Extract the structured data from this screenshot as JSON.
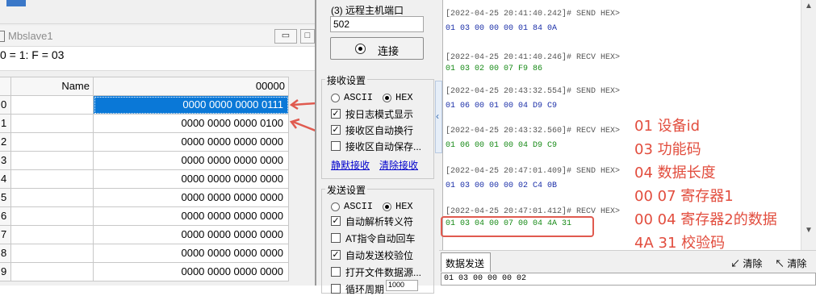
{
  "left_window": {
    "title": "Mbslave1",
    "status": "0 = 1: F = 03",
    "buttons": {
      "minimize": "▭",
      "maximize": "□"
    },
    "grid": {
      "header_name": "Name",
      "header_value": "00000",
      "rows": [
        {
          "num": "0",
          "value": "0000 0000 0000 0111",
          "selected": true
        },
        {
          "num": "1",
          "value": "0000 0000 0000 0100",
          "selected": false
        },
        {
          "num": "2",
          "value": "0000 0000 0000 0000",
          "selected": false
        },
        {
          "num": "3",
          "value": "0000 0000 0000 0000",
          "selected": false
        },
        {
          "num": "4",
          "value": "0000 0000 0000 0000",
          "selected": false
        },
        {
          "num": "5",
          "value": "0000 0000 0000 0000",
          "selected": false
        },
        {
          "num": "6",
          "value": "0000 0000 0000 0000",
          "selected": false
        },
        {
          "num": "7",
          "value": "0000 0000 0000 0000",
          "selected": false
        },
        {
          "num": "8",
          "value": "0000 0000 0000 0000",
          "selected": false
        },
        {
          "num": "9",
          "value": "0000 0000 0000 0000",
          "selected": false
        }
      ]
    }
  },
  "right_window": {
    "remote_port_label": "(3) 远程主机端口",
    "remote_port_value": "502",
    "connect_button": "连接",
    "recv_settings": {
      "group_label": "接收设置",
      "ascii": "ASCII",
      "hex": "HEX",
      "options": [
        "按日志模式显示",
        "接收区自动换行",
        "接收区自动保存..."
      ],
      "checked": [
        true,
        true,
        false
      ],
      "link_save": "静默接收",
      "link_clear": "清除接收"
    },
    "send_settings": {
      "group_label": "发送设置",
      "ascii": "ASCII",
      "hex": "HEX",
      "options": [
        "自动解析转义符",
        "AT指令自动回车",
        "自动发送校验位",
        "打开文件数据源...",
        "循环周期"
      ],
      "checked": [
        true,
        false,
        true,
        false,
        false
      ],
      "cycle_value": "1000"
    },
    "log": [
      {
        "kind": "hdr",
        "text": "[2022-04-25 20:41:40.242]# SEND HEX>"
      },
      {
        "kind": "send",
        "text": "01 03 00 00 00 01 84 0A"
      },
      {
        "kind": "hdr",
        "text": "[2022-04-25 20:41:40.246]# RECV HEX>"
      },
      {
        "kind": "recv",
        "text": "01 03 02 00 07 F9 86"
      },
      {
        "kind": "hdr",
        "text": "[2022-04-25 20:43:32.554]# SEND HEX>"
      },
      {
        "kind": "send",
        "text": "01 06 00 01 00 04 D9 C9"
      },
      {
        "kind": "hdr",
        "text": "[2022-04-25 20:43:32.560]# RECV HEX>"
      },
      {
        "kind": "recv",
        "text": "01 06 00 01 00 04 D9 C9"
      },
      {
        "kind": "hdr",
        "text": "[2022-04-25 20:47:01.409]# SEND HEX>"
      },
      {
        "kind": "send",
        "text": "01 03 00 00 00 02 C4 0B"
      },
      {
        "kind": "hdr",
        "text": "[2022-04-25 20:47:01.412]# RECV HEX>"
      },
      {
        "kind": "recv",
        "text": "01 03 04 00 07 00 04 4A 31"
      }
    ],
    "annotations": [
      "01 设备id",
      "03 功能码",
      "04 数据长度",
      "00 07 寄存器1",
      "00 04 寄存器2的数据",
      "4A 31 校验码"
    ],
    "bottom": {
      "tab_label": "数据发送",
      "clear1": "清除",
      "clear2": "清除",
      "send_text": "01 03 00 00 00 02"
    }
  },
  "colors": {
    "selection": "#0a78d7",
    "annotation": "#e24d3e",
    "send": "#1b2fa8",
    "recv": "#178a17"
  }
}
